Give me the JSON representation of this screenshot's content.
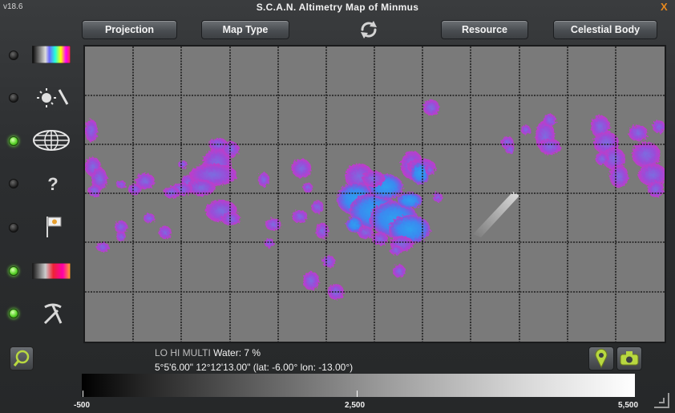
{
  "window": {
    "version": "v18.6",
    "title": "S.C.A.N. Altimetry Map of Minmus",
    "close_label": "X"
  },
  "toolbar": {
    "projection_label": "Projection",
    "map_type_label": "Map Type",
    "resource_label": "Resource",
    "celestial_body_label": "Celestial Body"
  },
  "sidebar": {
    "toggles": [
      {
        "icon": "color-palette-icon",
        "state": "off"
      },
      {
        "icon": "terminator-sun-icon",
        "state": "off"
      },
      {
        "icon": "grid-globe-icon",
        "state": "on"
      },
      {
        "icon": "anomaly-question-icon",
        "state": "off"
      },
      {
        "icon": "flag-icon",
        "state": "off"
      },
      {
        "icon": "resource-overlay-icon",
        "state": "on"
      },
      {
        "icon": "pickaxe-icon",
        "state": "on"
      }
    ]
  },
  "info": {
    "mode_label": "LO HI MULTI",
    "resource_label": "Water: 7 %",
    "coordinates": "5°5'6.00\" 12°12'13.00\" (lat: -6.00° lon: -13.00°)"
  },
  "legend": {
    "min_label": "-500",
    "mid_label": "2,500",
    "max_label": "5,500"
  },
  "colors": {
    "accent": "#e8891d",
    "map_background": "#7a7a7a",
    "resource_low": "#c03cc8",
    "resource_high": "#2ea0f0",
    "led_on": "#5ad42a"
  }
}
